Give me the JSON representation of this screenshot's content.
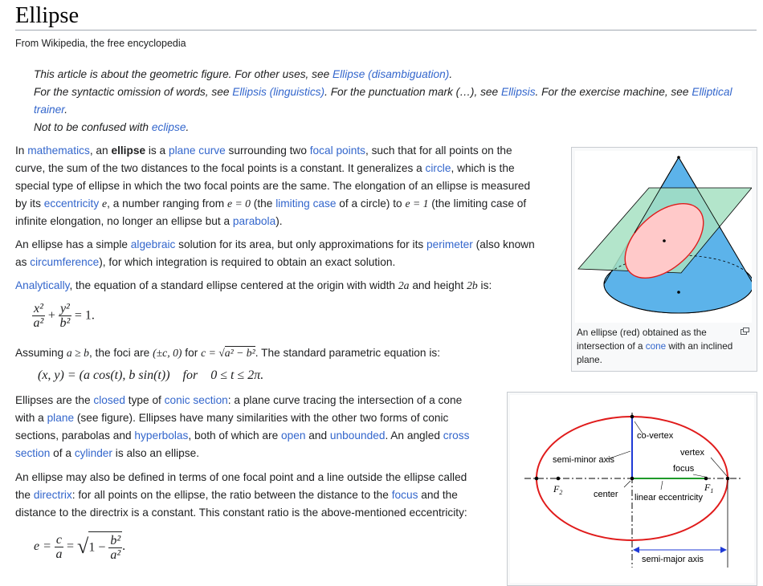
{
  "page": {
    "title": "Ellipse",
    "tagline": "From Wikipedia, the free encyclopedia"
  },
  "hatnotes": {
    "line1_pre": "This article is about the geometric figure. For other uses, see ",
    "line1_link": "Ellipse (disambiguation)",
    "line1_post": ".",
    "line2_pre": "For the syntactic omission of words, see ",
    "line2_link1": "Ellipsis (linguistics)",
    "line2_mid1": ". For the punctuation mark (…), see ",
    "line2_link2": "Ellipsis",
    "line2_mid2": ". For the exercise machine, see ",
    "line2_link3a": "Elliptical",
    "line2_link3b": "trainer",
    "line2_post": ".",
    "line3_pre": "Not to be confused with ",
    "line3_link": "eclipse",
    "line3_post": "."
  },
  "intro": {
    "l1_t1": "In ",
    "l1_a1": "mathematics",
    "l1_t2": ", an ",
    "l1_b": "ellipse",
    "l1_t3": " is a ",
    "l1_a2": "plane curve",
    "l1_t4": " surrounding two ",
    "l1_a3": "focal points",
    "l1_t5": ", such that for all points on the",
    "l2_t1": "curve, the sum of the two distances to the focal points is a constant. It generalizes a ",
    "l2_a1": "circle",
    "l2_t2": ", which is the",
    "l3_t1": "special type of ellipse in which the two focal points are the same. The elongation of an ellipse is measured",
    "l4_t1": "by its ",
    "l4_a1": "eccentricity",
    "l4_e": "e",
    "l4_t2": ", a number ranging from ",
    "l4_m1": "e = 0",
    "l4_t3": " (the ",
    "l4_a2": "limiting case",
    "l4_t4": " of a circle) to ",
    "l4_m2": "e = 1",
    "l4_t5": " (the limiting case of",
    "l5_t1": "infinite elongation, no longer an ellipse but a ",
    "l5_a1": "parabola",
    "l5_t2": ")."
  },
  "p2": {
    "l1_t1": "An ellipse has a simple ",
    "l1_a1": "algebraic",
    "l1_t2": " solution for its area, but only approximations for its ",
    "l1_a2": "perimeter",
    "l1_t3": " (also known",
    "l2_t1": "as ",
    "l2_a1": "circumference",
    "l2_t2": "), for which integration is required to obtain an exact solution."
  },
  "p3": {
    "a1": "Analytically",
    "t1": ", the equation of a standard ellipse centered at the origin with width ",
    "m1": "2a",
    "t2": " and height ",
    "m2": "2b",
    "t3": " is:"
  },
  "eq1": {
    "n1": "x²",
    "d1": "a²",
    "plus": "+",
    "n2": "y²",
    "d2": "b²",
    "rhs": "= 1."
  },
  "p4": {
    "t1": "Assuming ",
    "m1": "a ≥ b",
    "t2": ", the foci are ",
    "m2": "(±c, 0)",
    "t3": " for ",
    "m3": "c = ",
    "m3sq": "a² − b²",
    "t4": ". The standard parametric equation is:"
  },
  "eq2": {
    "text": "(x, y) = (a cos(t), b sin(t))    for    0 ≤ t ≤ 2π."
  },
  "p5": {
    "l1_t1": "Ellipses are the ",
    "l1_a1": "closed",
    "l1_t2": " type of ",
    "l1_a2": "conic section",
    "l1_t3": ": a plane curve tracing the intersection of a cone",
    "l2_t1": "with a ",
    "l2_a1": "plane",
    "l2_t2": " (see figure). Ellipses have many similarities with the other two forms of conic",
    "l3_t1": "sections, parabolas and ",
    "l3_a1": "hyperbolas",
    "l3_t2": ", both of which are ",
    "l3_a2": "open",
    "l3_t3": " and ",
    "l3_a3": "unbounded",
    "l3_t4": ". An angled ",
    "l3_a4": "cross",
    "l4_a1": "section",
    "l4_t1": " of a ",
    "l4_a2": "cylinder",
    "l4_t2": " is also an ellipse."
  },
  "p6": {
    "l1_t1": "An ellipse may also be defined in terms of one focal point and a line outside the ellipse called",
    "l2_t1": "the ",
    "l2_a1": "directrix",
    "l2_t2": ": for all points on the ellipse, the ratio between the distance to the ",
    "l2_a2": "focus",
    "l2_t3": " and the",
    "l3_t1": "distance to the directrix is a constant. This constant ratio is the above-mentioned eccentricity:"
  },
  "eq3": {
    "lhs": "e =",
    "n1": "c",
    "d1": "a",
    "eq": "=",
    "one": "1 −",
    "n2": "b²",
    "d2": "a²",
    "end": "."
  },
  "figure1": {
    "caption_l1": "An ellipse (red) obtained as the",
    "caption_l2_t": "intersection of a ",
    "caption_l2_a": "cone",
    "caption_l2_t2": " with an inclined",
    "caption_l3": "plane."
  },
  "figure2": {
    "co_vertex": "co-vertex",
    "vertex": "vertex",
    "semi_minor": "semi-minor axis",
    "focus": "focus",
    "f2": "F",
    "f2_sub": "2",
    "f1": "F",
    "f1_sub": "1",
    "center": "center",
    "linear_ecc": "linear eccentricity",
    "semi_major": "semi-major axis"
  }
}
